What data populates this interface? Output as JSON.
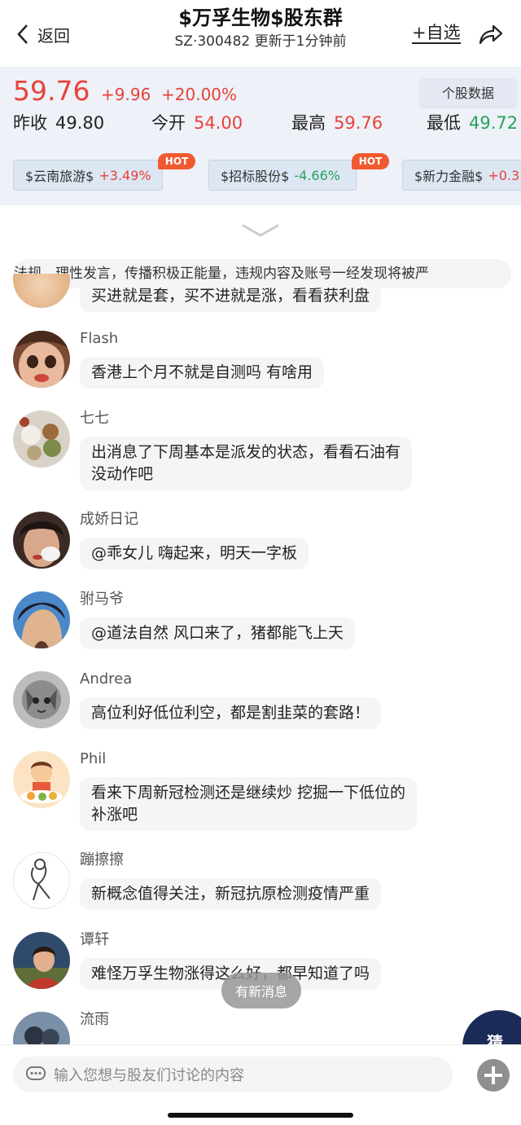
{
  "header": {
    "back_label": "返回",
    "title": "$万孚生物$股东群",
    "subtitle": "SZ·300482  更新于1分钟前",
    "add_fav": "+自选"
  },
  "quote": {
    "price": "59.76",
    "change": "+9.96",
    "change_pct": "+20.00%",
    "stock_data_button": "个股数据",
    "prev_close_label": "昨收",
    "prev_close": "49.80",
    "open_label": "今开",
    "open": "54.00",
    "high_label": "最高",
    "high": "59.76",
    "low_label": "最低",
    "low": "49.72",
    "up_color": "#e8413b",
    "down_color": "#27a35a"
  },
  "chips": [
    {
      "name": "$云南旅游$",
      "change": "+3.49%",
      "hot": "HOT"
    },
    {
      "name": "$招标股份$",
      "change": "-4.66%",
      "hot": "HOT"
    },
    {
      "name": "$新力金融$",
      "change": "+0.3",
      "hot": ""
    }
  ],
  "notice": "律法规，理性发言，传播积极正能量，违规内容及账号一经发现将被严",
  "first_message": "买进就是套，买不进就是涨，看看获利盘",
  "messages": [
    {
      "user": "Flash",
      "text": "香港上个月不就是自测吗 有啥用"
    },
    {
      "user": "七七",
      "text": "出消息了下周基本是派发的状态，看看石油有\n没动作吧"
    },
    {
      "user": "成娇日记",
      "text": "@乖女儿 嗨起来，明天一字板"
    },
    {
      "user": "驸马爷",
      "text": "@道法自然 风口来了，猪都能飞上天"
    },
    {
      "user": "Andrea",
      "text": "高位利好低位利空，都是割韭菜的套路！"
    },
    {
      "user": "Phil",
      "text": "看来下周新冠检测还是继续炒 挖掘一下低位的\n补涨吧"
    },
    {
      "user": "蹦擦擦",
      "text": "新概念值得关注，新冠抗原检测疫情严重"
    },
    {
      "user": "谭轩",
      "text": "难怪万孚生物涨得这么好，都早知道了吗"
    },
    {
      "user": "流雨",
      "text": ""
    }
  ],
  "new_message_pill": "有新消息",
  "guess_button": "猜",
  "input_placeholder": "输入您想与股友们讨论的内容"
}
